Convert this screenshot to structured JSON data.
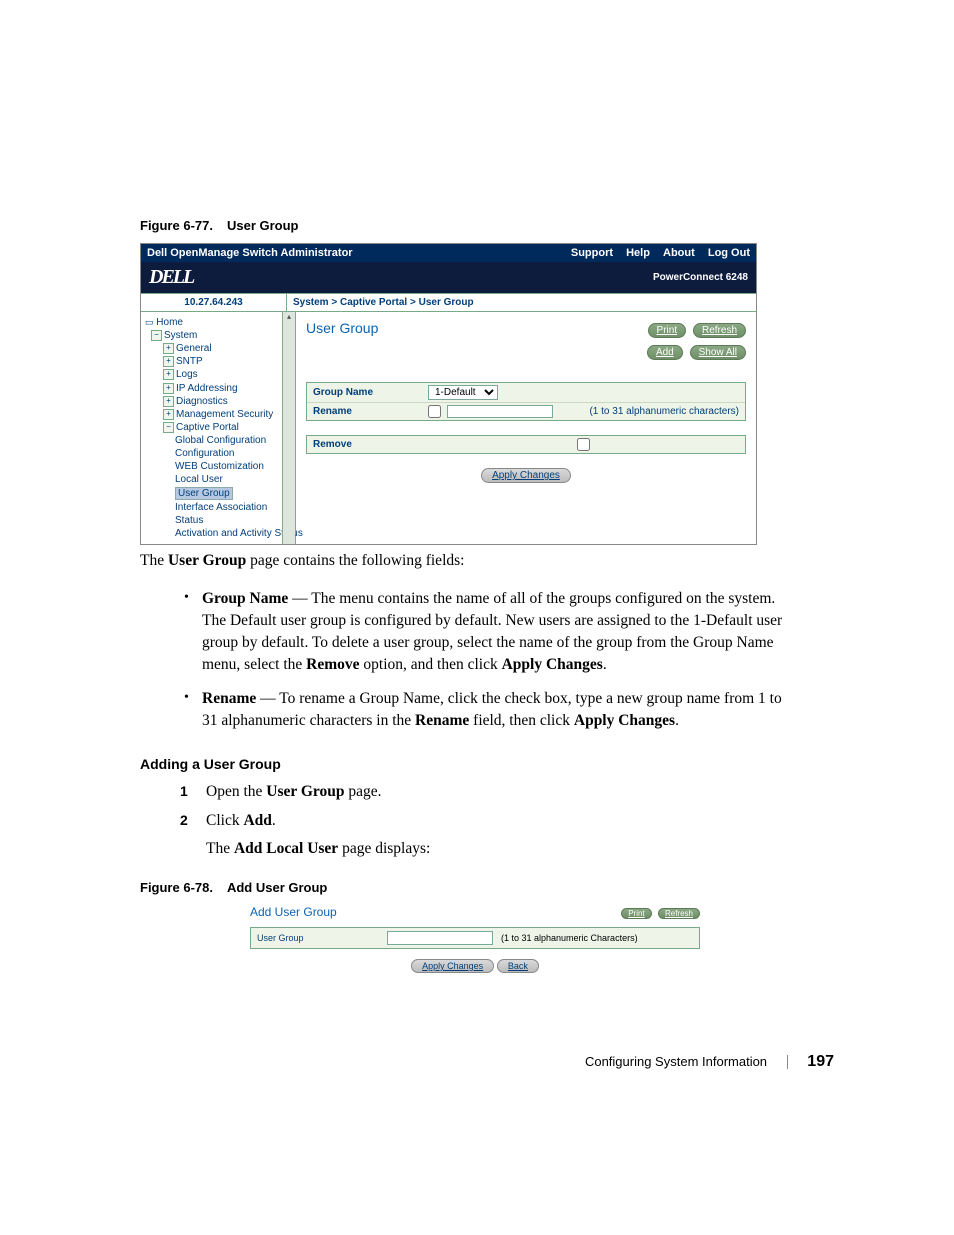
{
  "fig1": {
    "num": "Figure 6-77.",
    "title": "User Group"
  },
  "shot1": {
    "titlebar": {
      "left": "Dell OpenManage Switch Administrator",
      "links": [
        "Support",
        "Help",
        "About",
        "Log Out"
      ]
    },
    "brand": "DELL",
    "model": "PowerConnect 6248",
    "ip": "10.27.64.243",
    "crumb": "System > Captive Portal > User Group",
    "tree": {
      "home": "Home",
      "system": "System",
      "items": [
        "General",
        "SNTP",
        "Logs",
        "IP Addressing",
        "Diagnostics",
        "Management Security"
      ],
      "captive": "Captive Portal",
      "cap_items": [
        "Global Configuration",
        "Configuration",
        "WEB Customization",
        "Local User",
        "User Group",
        "Interface Association",
        "Status",
        "Activation and Activity Status"
      ]
    },
    "content": {
      "title": "User Group",
      "buttons": {
        "print": "Print",
        "refresh": "Refresh",
        "add": "Add",
        "showall": "Show All"
      },
      "group_name_label": "Group Name",
      "group_name_value": "1-Default",
      "rename_label": "Rename",
      "rename_hint": "(1 to 31 alphanumeric characters)",
      "remove_label": "Remove",
      "apply": "Apply Changes"
    }
  },
  "para1": {
    "lead_the": "The ",
    "lead_b": "User Group",
    "lead_end": " page contains the following fields:"
  },
  "bullets": [
    {
      "label": "Group Name",
      "dash": " — ",
      "t1": "The menu contains the name of all of the groups configured on the system. The Default user group is configured by default. New users are assigned to the 1-Default user group by default. To delete a user group, select the name of the group from the Group Name menu, select the ",
      "b2": "Remove",
      "t2": " option, and then click ",
      "b3": "Apply Changes",
      "t3": "."
    },
    {
      "label": "Rename",
      "dash": " — ",
      "t1": "To rename a Group Name, click the check box, type a new group name from 1 to 31 alphanumeric characters in the ",
      "b2": "Rename",
      "t2": " field, then click ",
      "b3": "Apply Changes",
      "t3": "."
    }
  ],
  "section": "Adding a User Group",
  "steps": [
    {
      "a": "Open the ",
      "b": "User Group",
      "c": " page."
    },
    {
      "a": "Click ",
      "b": "Add",
      "c": "."
    }
  ],
  "sub": {
    "a": "The ",
    "b": "Add Local User",
    "c": " page displays:"
  },
  "fig2": {
    "num": "Figure 6-78.",
    "title": "Add User Group"
  },
  "shot2": {
    "title": "Add User Group",
    "print": "Print",
    "refresh": "Refresh",
    "field_label": "User Group",
    "hint": "(1 to 31 alphanumeric Characters)",
    "apply": "Apply Changes",
    "back": "Back"
  },
  "footer": {
    "chapter": "Configuring System Information",
    "page": "197"
  }
}
